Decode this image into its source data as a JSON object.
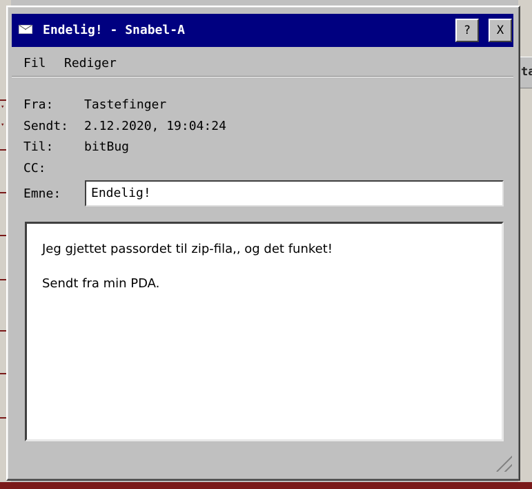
{
  "window": {
    "title": "Endelig! - Snabel-A",
    "help_label": "?",
    "close_label": "X"
  },
  "menu": {
    "items": [
      {
        "label": "Fil"
      },
      {
        "label": "Rediger"
      }
    ]
  },
  "headers": {
    "from_label": "Fra:",
    "from_value": "Tastefinger",
    "sent_label": "Sendt:",
    "sent_value": "2.12.2020, 19:04:24",
    "to_label": "Til:",
    "to_value": "bitBug",
    "cc_label": "CC:",
    "cc_value": "",
    "subject_label": "Emne:",
    "subject_value": "Endelig!"
  },
  "message": {
    "lines": [
      "Jeg gjettet passordet til zip-fila,, og det funket!",
      "Sendt fra min PDA."
    ]
  },
  "background": {
    "right_text": "ta"
  },
  "icons": {
    "title": "envelope-icon",
    "resize": "resize-grip-icon"
  },
  "colors": {
    "titlebar": "#000080",
    "window": "#c0c0c0",
    "background_accent": "#7a1a1a"
  }
}
